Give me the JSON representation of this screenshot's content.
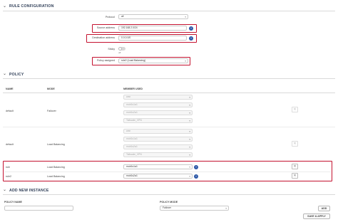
{
  "rule_configuration": {
    "title": "RULE CONFIGURATION",
    "protocol": {
      "label": "Protocol",
      "value": "all"
    },
    "source_address": {
      "label": "Source address",
      "value": "192.168.2.0/24"
    },
    "destination_address": {
      "label": "Destination address",
      "value": "0.0.0.0/0"
    },
    "sticky": {
      "label": "Sticky",
      "state": "off",
      "state_text": "off"
    },
    "policy_assigned": {
      "label": "Policy assigned",
      "value": "rule2 (Load Balancing)"
    }
  },
  "policy": {
    "title": "POLICY",
    "columns": [
      "NAME",
      "MODE",
      "MEMBER USED"
    ],
    "rows": [
      {
        "name": "default",
        "mode": "Failover",
        "members": [
          "wan",
          "mob1s1a1",
          "mob1s2a1",
          "Tailscale_VPN"
        ],
        "active": false
      },
      {
        "name": "default",
        "mode": "Load Balancing",
        "members": [
          "wan",
          "mob1s1a1",
          "mob1s2a1",
          "Tailscale_VPN"
        ],
        "active": false
      },
      {
        "name": "rule",
        "mode": "Load Balancing",
        "members": [
          "mob1s1a1"
        ],
        "active": true
      },
      {
        "name": "rule2",
        "mode": "Load Balancing",
        "members": [
          "mob1s2a1"
        ],
        "active": true
      }
    ]
  },
  "add_new_instance": {
    "title": "ADD NEW INSTANCE",
    "policy_name_label": "POLICY NAME",
    "policy_name_value": "",
    "policy_mode_label": "POLICY MODE",
    "policy_mode_value": "Failover",
    "add_label": "ADD"
  },
  "save_apply_label": "SAVE & APPLY",
  "icons": {
    "add": "plus-icon",
    "delete": "x-icon",
    "collapse": "chevron-down-icon",
    "dropdown": "caret-down-icon"
  },
  "colors": {
    "highlight": "#c4122f",
    "accent": "#2f5aa8",
    "section_title": "#2f3e57"
  }
}
